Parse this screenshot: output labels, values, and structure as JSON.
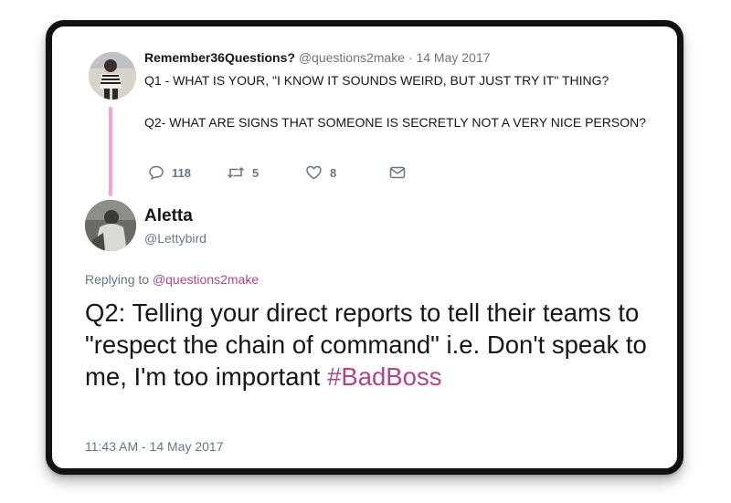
{
  "thread": {
    "original": {
      "display_name": "Remember36Questions?",
      "handle": "@questions2make",
      "separator": "·",
      "date": "14 May 2017",
      "paragraphs": [
        "Q1 - WHAT IS YOUR, \"I KNOW IT SOUNDS WEIRD, BUT JUST TRY IT\" THING?",
        "Q2- WHAT ARE SIGNS THAT SOMEONE IS SECRETLY NOT A VERY NICE PERSON?"
      ],
      "actions": {
        "reply_icon": "reply-icon",
        "reply_count": "118",
        "retweet_icon": "retweet-icon",
        "retweet_count": "5",
        "like_icon": "heart-icon",
        "like_count": "8",
        "dm_icon": "envelope-icon"
      }
    },
    "reply": {
      "display_name": "Aletta",
      "handle": "@Lettybird",
      "replying_to_prefix": "Replying to",
      "replying_to_handle": "@questions2make",
      "text": "Q2: Telling your direct reports to tell their teams to \"respect the chain of command\" i.e. Don't speak to me, I'm too important",
      "hashtag": "#BadBoss",
      "timestamp": "11:43 AM - 14 May 2017"
    }
  },
  "colors": {
    "text": "#14171a",
    "muted": "#657786",
    "link": "#b0458e",
    "thread_line": "#f2a6cd",
    "frame": "#111111"
  }
}
